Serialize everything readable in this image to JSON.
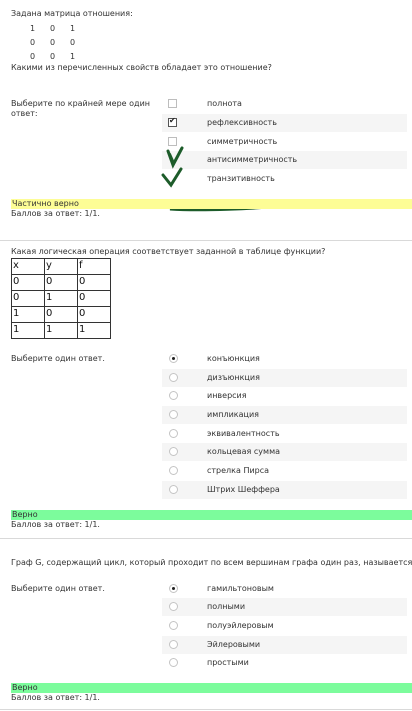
{
  "q1": {
    "intro": "Задана матрица отношения:",
    "matrix": [
      [
        "1",
        "0",
        "1"
      ],
      [
        "0",
        "0",
        "0"
      ],
      [
        "0",
        "0",
        "1"
      ]
    ],
    "question": "Какими из перечисленных свойств обладает это отношение?",
    "prompt": "Выберите по крайней мере один ответ:",
    "options": [
      {
        "label": "полнота",
        "checked": false
      },
      {
        "label": "рефлексивность",
        "checked": true
      },
      {
        "label": "симметричность",
        "checked": false
      },
      {
        "label": "антисимметричность",
        "checked": false
      },
      {
        "label": "транзитивность",
        "checked": false
      }
    ],
    "feedback": "Частично верно",
    "feedback_color": "#fdfd96",
    "score": "Баллов за ответ: 1/1."
  },
  "q2": {
    "question": "Какая логическая операция соответствует заданной в таблице функции?",
    "table": [
      [
        "x",
        "y",
        "f"
      ],
      [
        "0",
        "0",
        "0"
      ],
      [
        "0",
        "1",
        "0"
      ],
      [
        "1",
        "0",
        "0"
      ],
      [
        "1",
        "1",
        "1"
      ]
    ],
    "prompt": "Выберите один ответ.",
    "options": [
      {
        "label": "конъюнкция",
        "selected": true
      },
      {
        "label": "дизъюнкция",
        "selected": false
      },
      {
        "label": "инверсия",
        "selected": false
      },
      {
        "label": "импликация",
        "selected": false
      },
      {
        "label": "эквивалентность",
        "selected": false
      },
      {
        "label": "кольцевая сумма",
        "selected": false
      },
      {
        "label": "стрелка Пирса",
        "selected": false
      },
      {
        "label": "Штрих Шеффера",
        "selected": false
      }
    ],
    "feedback": "Верно",
    "feedback_color": "#7cfc9c",
    "score": "Баллов за ответ: 1/1."
  },
  "q3": {
    "question": "Граф G, содержащий цикл, который проходит по всем вершинам графа один раз, называется",
    "prompt": "Выберите один ответ.",
    "options": [
      {
        "label": "гамильтоновым",
        "selected": true
      },
      {
        "label": "полными",
        "selected": false
      },
      {
        "label": "полуэйлеровым",
        "selected": false
      },
      {
        "label": "Эйлеровыми",
        "selected": false
      },
      {
        "label": "простыми",
        "selected": false
      }
    ],
    "feedback": "Верно",
    "feedback_color": "#7cfc9c",
    "score": "Баллов за ответ: 1/1."
  },
  "annotations": {
    "ink_color": "#1d5c2a",
    "marks": [
      "checkmark-icon",
      "checkmark-icon",
      "scribble"
    ]
  }
}
